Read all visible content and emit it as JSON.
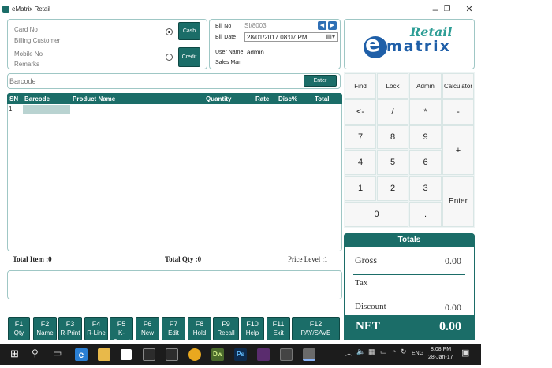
{
  "window": {
    "title": "eMatrix Retail",
    "minimize": "–",
    "restore": "❐",
    "close": "✕"
  },
  "customer": {
    "card_no_label": "Card No",
    "billing_customer_label": "Billing Customer",
    "mobile_no_label": "Mobile No",
    "remarks_label": "Remarks",
    "payment_mode": "cash",
    "cash_label": "Cash",
    "credit_label": "Credit"
  },
  "bill": {
    "bill_no_label": "Bill No",
    "bill_no_value": "SI/8003",
    "bill_date_label": "Bill Date",
    "bill_date_value": "28/01/2017 08:07 PM",
    "user_name_label": "User Name",
    "user_name_value": "admin",
    "sales_man_label": "Sales Man"
  },
  "logo": {
    "retail": "Retail",
    "brand": "ematrix"
  },
  "barcode": {
    "placeholder": "Barcode",
    "enter_label": "Enter"
  },
  "grid": {
    "columns": [
      "SN",
      "Barcode",
      "Product Name",
      "Quantity",
      "Rate",
      "Disc%",
      "Total"
    ],
    "rows": [
      {
        "sn": "1"
      }
    ]
  },
  "summary": {
    "total_item": "Total Item  :0",
    "total_qty": "Total Qty  :0",
    "price_level": "Price Level :1"
  },
  "keypad": {
    "find": "Find",
    "lock": "Lock",
    "admin": "Admin",
    "calculator": "Calculator",
    "backspace": "<-",
    "divide": "/",
    "multiply": "*",
    "minus": "-",
    "k7": "7",
    "k8": "8",
    "k9": "9",
    "plus": "+",
    "k4": "4",
    "k5": "5",
    "k6": "6",
    "k1": "1",
    "k2": "2",
    "k3": "3",
    "enter": "Enter",
    "k0": "0",
    "dot": "."
  },
  "totals": {
    "title": "Totals",
    "gross_label": "Gross",
    "gross_value": "0.00",
    "tax_label": "Tax",
    "discount_label": "Discount",
    "discount_value": "0.00",
    "net_label": "NET",
    "net_value": "0.00"
  },
  "function_keys": [
    {
      "key": "F1",
      "label": "Qty"
    },
    {
      "key": "F2",
      "label": "Name"
    },
    {
      "key": "F3",
      "label": "R-Print"
    },
    {
      "key": "F4",
      "label": "R-Line"
    },
    {
      "key": "F5",
      "label": "K-Board"
    },
    {
      "key": "F6",
      "label": "New"
    },
    {
      "key": "F7",
      "label": "Edit"
    },
    {
      "key": "F8",
      "label": "Hold"
    },
    {
      "key": "F9",
      "label": "Recall"
    },
    {
      "key": "F10",
      "label": "Help"
    },
    {
      "key": "F11",
      "label": "Exit"
    },
    {
      "key": "F12",
      "label": "PAY/SAVE"
    }
  ],
  "taskbar": {
    "time": "8:08 PM",
    "date": "28-Jan-17",
    "language": "ENG",
    "dw_label": "Dw",
    "ps_label": "Ps"
  },
  "colors": {
    "accent": "#1b6d68",
    "logo_blue": "#1f5fa8",
    "logo_teal": "#2e9e96"
  }
}
